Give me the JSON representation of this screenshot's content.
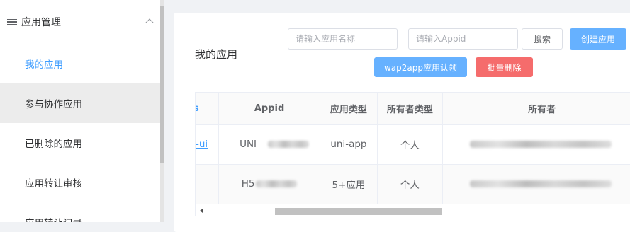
{
  "sidebar": {
    "group_label": "应用管理",
    "items": [
      {
        "label": "我的应用"
      },
      {
        "label": "参与协作应用"
      },
      {
        "label": "已删除的应用"
      },
      {
        "label": "应用转让审核"
      },
      {
        "label": "应用转让记录"
      }
    ]
  },
  "main": {
    "title": "我的应用",
    "search": {
      "name_placeholder": "请输入应用名称",
      "appid_placeholder": "请输入Appid",
      "search_label": "搜索",
      "create_label": "创建应用",
      "wap2app_label": "wap2app应用认领",
      "batch_delete_label": "批量删除"
    },
    "table": {
      "headers": {
        "name_partial": "s",
        "appid": "Appid",
        "type": "应用类型",
        "owner_type": "所有者类型",
        "owner": "所有者"
      },
      "rows": [
        {
          "name_partial": "-ui",
          "appid": "__UNI__",
          "type": "uni-app",
          "owner_type": "个人"
        },
        {
          "name_partial": "",
          "appid": "H5",
          "type": "5+应用",
          "owner_type": "个人"
        }
      ]
    }
  },
  "colors": {
    "accent": "#409eff",
    "primary_button": "#66b1ff",
    "danger_button": "#f56c6c"
  }
}
